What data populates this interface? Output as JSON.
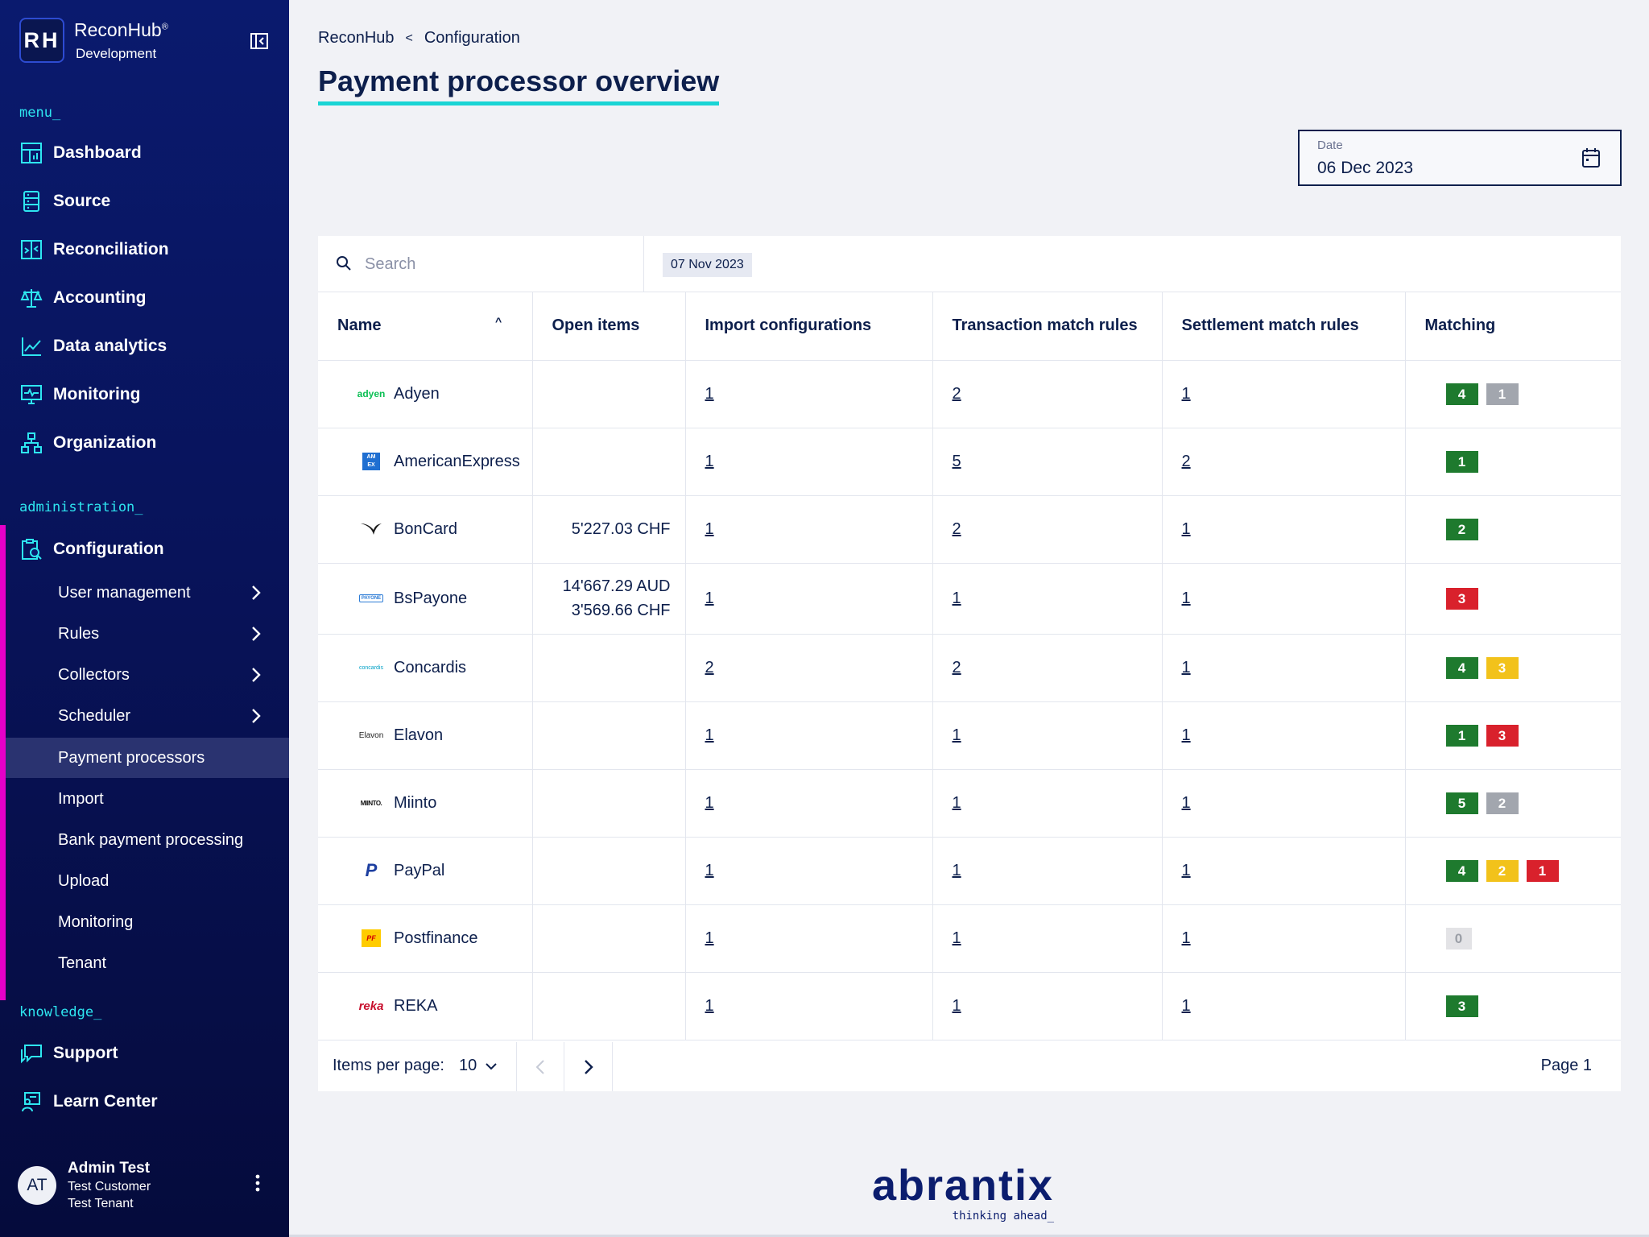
{
  "brand": {
    "logo": "RH",
    "name": "ReconHub",
    "reg": "®",
    "env": "Development"
  },
  "sidebar": {
    "menu_label": "menu_",
    "menu": [
      {
        "label": "Dashboard",
        "icon": "dashboard-icon"
      },
      {
        "label": "Source",
        "icon": "source-icon"
      },
      {
        "label": "Reconciliation",
        "icon": "reconciliation-icon"
      },
      {
        "label": "Accounting",
        "icon": "scales-icon"
      },
      {
        "label": "Data analytics",
        "icon": "chart-icon"
      },
      {
        "label": "Monitoring",
        "icon": "monitor-icon"
      },
      {
        "label": "Organization",
        "icon": "org-icon"
      }
    ],
    "admin_label": "administration_",
    "configuration": "Configuration",
    "sub": [
      {
        "label": "User management",
        "expandable": true
      },
      {
        "label": "Rules",
        "expandable": true
      },
      {
        "label": "Collectors",
        "expandable": true
      },
      {
        "label": "Scheduler",
        "expandable": true
      },
      {
        "label": "Payment processors",
        "expandable": false,
        "active": true
      },
      {
        "label": "Import",
        "expandable": false
      },
      {
        "label": "Bank payment processing",
        "expandable": false
      },
      {
        "label": "Upload",
        "expandable": false
      },
      {
        "label": "Monitoring",
        "expandable": false
      },
      {
        "label": "Tenant",
        "expandable": false
      }
    ],
    "knowledge_label": "knowledge_",
    "knowledge": [
      {
        "label": "Support",
        "icon": "support-icon"
      },
      {
        "label": "Learn Center",
        "icon": "learn-icon"
      }
    ]
  },
  "user": {
    "initials": "AT",
    "name": "Admin Test",
    "customer": "Test Customer",
    "tenant": "Test Tenant"
  },
  "breadcrumb": {
    "root": "ReconHub",
    "sep": "<",
    "current": "Configuration"
  },
  "page_title": "Payment processor overview",
  "date": {
    "label": "Date",
    "value": "06 Dec 2023"
  },
  "search": {
    "placeholder": "Search"
  },
  "filter_chip": "07 Nov 2023",
  "columns": [
    "Name",
    "Open items",
    "Import configurations",
    "Transaction match rules",
    "Settlement match rules",
    "Matching"
  ],
  "rows": [
    {
      "name": "Adyen",
      "logo": "adyen",
      "open": [],
      "import": "1",
      "trx": "2",
      "settle": "1",
      "matching": [
        {
          "v": "4",
          "c": "green"
        },
        {
          "v": "1",
          "c": "gray"
        }
      ]
    },
    {
      "name": "AmericanExpress",
      "logo": "AM EX",
      "open": [],
      "import": "1",
      "trx": "5",
      "settle": "2",
      "matching": [
        {
          "v": "1",
          "c": "green"
        }
      ]
    },
    {
      "name": "BonCard",
      "logo": "",
      "open": [
        "5'227.03 CHF"
      ],
      "import": "1",
      "trx": "2",
      "settle": "1",
      "matching": [
        {
          "v": "2",
          "c": "green"
        }
      ]
    },
    {
      "name": "BsPayone",
      "logo": "PAYONE",
      "open": [
        "14'667.29 AUD",
        "3'569.66 CHF"
      ],
      "import": "1",
      "trx": "1",
      "settle": "1",
      "matching": [
        {
          "v": "3",
          "c": "red"
        }
      ]
    },
    {
      "name": "Concardis",
      "logo": "concardis",
      "open": [],
      "import": "2",
      "trx": "2",
      "settle": "1",
      "matching": [
        {
          "v": "4",
          "c": "green"
        },
        {
          "v": "3",
          "c": "yellow"
        }
      ]
    },
    {
      "name": "Elavon",
      "logo": "Elavon",
      "open": [],
      "import": "1",
      "trx": "1",
      "settle": "1",
      "matching": [
        {
          "v": "1",
          "c": "green"
        },
        {
          "v": "3",
          "c": "red"
        }
      ]
    },
    {
      "name": "Miinto",
      "logo": "MIINTO.",
      "open": [],
      "import": "1",
      "trx": "1",
      "settle": "1",
      "matching": [
        {
          "v": "5",
          "c": "green"
        },
        {
          "v": "2",
          "c": "gray"
        }
      ]
    },
    {
      "name": "PayPal",
      "logo": "P",
      "open": [],
      "import": "1",
      "trx": "1",
      "settle": "1",
      "matching": [
        {
          "v": "4",
          "c": "green"
        },
        {
          "v": "2",
          "c": "yellow"
        },
        {
          "v": "1",
          "c": "red"
        }
      ]
    },
    {
      "name": "Postfinance",
      "logo": "PF",
      "open": [],
      "import": "1",
      "trx": "1",
      "settle": "1",
      "matching": [
        {
          "v": "0",
          "c": "zero"
        }
      ]
    },
    {
      "name": "REKA",
      "logo": "reka",
      "open": [],
      "import": "1",
      "trx": "1",
      "settle": "1",
      "matching": [
        {
          "v": "3",
          "c": "green"
        }
      ]
    }
  ],
  "pagination": {
    "items_label": "Items per page:",
    "per_page": "10",
    "page_label": "Page 1"
  },
  "footer": {
    "company": "abrantix",
    "tagline": "thinking ahead_"
  },
  "colors": {
    "accent_cyan": "#2ee6f0",
    "brand_navy": "#0d1f4c",
    "admin_magenta": "#e600c8"
  }
}
